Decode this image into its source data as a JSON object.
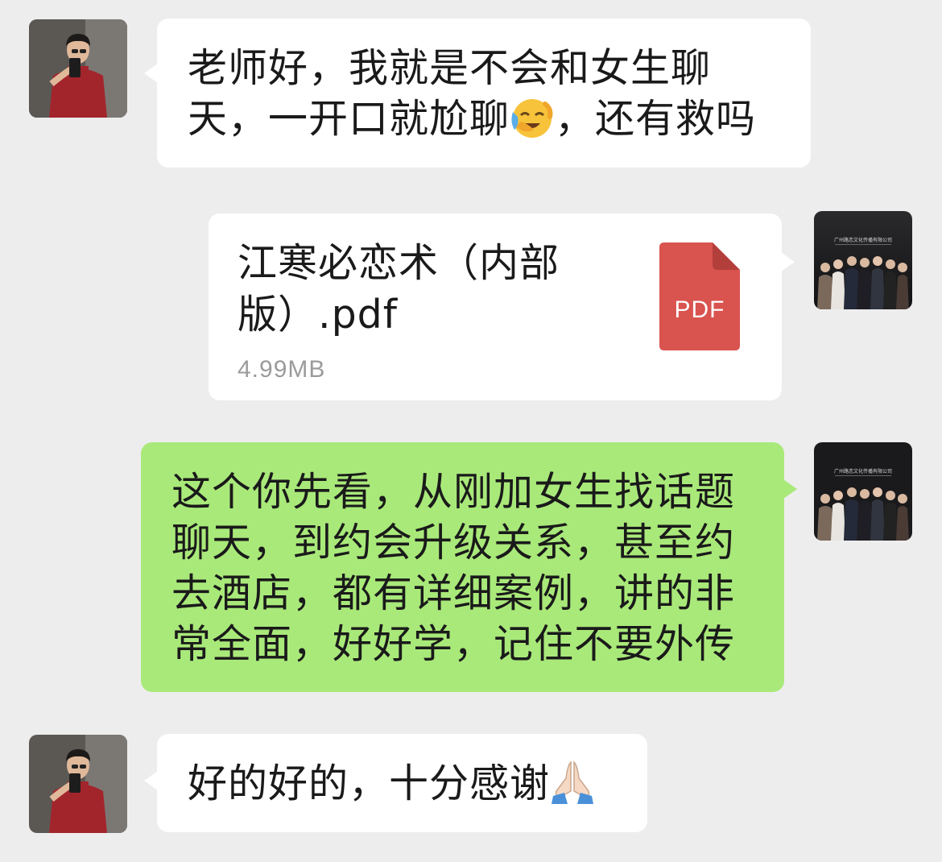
{
  "conversation": {
    "messages": [
      {
        "sender": "user",
        "type": "text",
        "line1": "老师好，我就是不会和女生聊",
        "line2_before_emoji": "天，一开口就尬聊",
        "emoji": "laughing-crying-emoji",
        "line2_after_emoji": "，还有救吗"
      },
      {
        "sender": "mentor",
        "type": "file",
        "file_name_line1": "江寒必恋术（内部",
        "file_name_line2": "版）.pdf",
        "file_size": "4.99MB",
        "file_badge": "PDF",
        "file_badge_color": "#d9534f"
      },
      {
        "sender": "mentor",
        "type": "text",
        "lines": [
          "这个你先看，从刚加女生找话题",
          "聊天，到约会升级关系，甚至约",
          "去酒店，都有详细案例，讲的非",
          "常全面，好好学，记住不要外传"
        ]
      },
      {
        "sender": "user",
        "type": "text",
        "text": "好的好的，十分感谢",
        "emoji": "folded-hands-emoji"
      }
    ]
  },
  "colors": {
    "background": "#ededed",
    "incoming_bubble": "#ffffff",
    "outgoing_bubble": "#a9e97a",
    "text": "#1a1a1a",
    "meta_text": "#9b9b9b"
  },
  "avatars": {
    "user": "user-avatar-photo",
    "mentor": "mentor-avatar-group-photo",
    "mentor_caption": "广州路恋文化传播有限公司"
  }
}
